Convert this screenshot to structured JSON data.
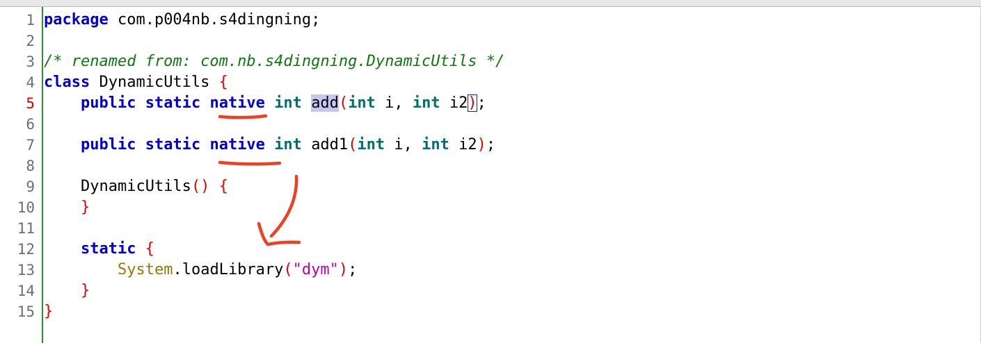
{
  "editor": {
    "line_numbers": [
      "1",
      "2",
      "3",
      "4",
      "5",
      "6",
      "7",
      "8",
      "9",
      "10",
      "11",
      "12",
      "13",
      "14",
      "15"
    ],
    "current_line": "5",
    "lines": {
      "l1": {
        "kw": "package",
        "rest": " com.p004nb.s4dingning;"
      },
      "l3": {
        "comment": "/* renamed from: com.nb.s4dingning.DynamicUtils */"
      },
      "l4": {
        "kw": "class",
        "name": " DynamicUtils ",
        "brace": "{"
      },
      "l5": {
        "indent": "    ",
        "kw1": "public",
        "kw2": "static",
        "kw3": "native",
        "type1": "int",
        "method": "add",
        "paren_open": "(",
        "type2": "int",
        "arg1": " i, ",
        "type3": "int",
        "arg2": " i2",
        "paren_close": ")",
        "end": ";"
      },
      "l7": {
        "indent": "    ",
        "kw1": "public",
        "kw2": "static",
        "kw3": "native",
        "type1": "int",
        "method": "add1",
        "paren_open": "(",
        "type2": "int",
        "arg1": " i, ",
        "type3": "int",
        "arg2": " i2",
        "paren_close": ")",
        "end": ";"
      },
      "l9": {
        "indent": "    ",
        "name": "DynamicUtils",
        "parens": "()",
        "brace": "{"
      },
      "l10": {
        "indent": "    ",
        "brace": "}"
      },
      "l12": {
        "indent": "    ",
        "kw": "static",
        "brace": "{"
      },
      "l13": {
        "indent": "        ",
        "cls": "System",
        "dot": ".",
        "method": "loadLibrary",
        "paren_open": "(",
        "str": "\"dym\"",
        "paren_close": ")",
        "end": ";"
      },
      "l14": {
        "indent": "    ",
        "brace": "}"
      },
      "l15": {
        "brace": "}"
      }
    }
  },
  "colors": {
    "keyword": "#0000d6",
    "type": "#007070",
    "comment": "#0e7a0e",
    "brace": "#e00000",
    "annotation": "#f04020",
    "gutter_line": "#2e8b2e"
  },
  "annotations": {
    "underline_1": "native (line 5)",
    "underline_2": "native (line 7)",
    "arrow": "curved arrow pointing down to static block"
  }
}
